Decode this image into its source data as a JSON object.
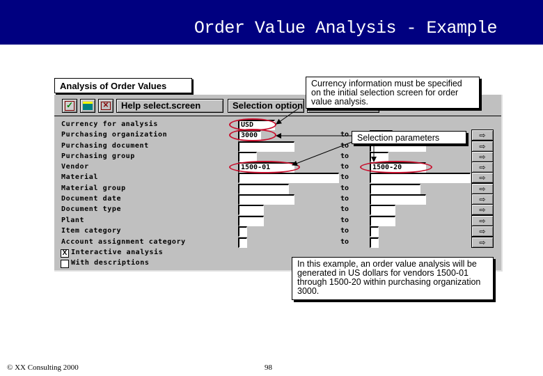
{
  "slide": {
    "title": "Order Value Analysis - Example",
    "footer_copyright": "© XX Consulting 2000",
    "page_number": "98"
  },
  "sap_window": {
    "title": "Analysis of Order Values",
    "toolbar": {
      "icons": [
        "execute-check-icon",
        "print-icon",
        "cancel-icon"
      ],
      "buttons": [
        "Help select.screen",
        "Selection options"
      ]
    },
    "rows": [
      {
        "label": "Currency for analysis",
        "from": "USD",
        "to_label": "",
        "to": "",
        "has_range": false
      },
      {
        "label": "Purchasing organization",
        "from": "3000",
        "to_label": "to",
        "to": "",
        "has_range": true
      },
      {
        "label": "Purchasing document",
        "from": "",
        "to_label": "to",
        "to": "",
        "has_range": true
      },
      {
        "label": "Purchasing group",
        "from": "",
        "to_label": "to",
        "to": "",
        "has_range": true
      },
      {
        "label": "Vendor",
        "from": "1500-01",
        "to_label": "to",
        "to": "1500-20",
        "has_range": true
      },
      {
        "label": "Material",
        "from": "",
        "to_label": "to",
        "to": "",
        "has_range": true
      },
      {
        "label": "Material group",
        "from": "",
        "to_label": "to",
        "to": "",
        "has_range": true
      },
      {
        "label": "Document date",
        "from": "",
        "to_label": "to",
        "to": "",
        "has_range": true
      },
      {
        "label": "Document type",
        "from": "",
        "to_label": "to",
        "to": "",
        "has_range": true
      },
      {
        "label": "Plant",
        "from": "",
        "to_label": "to",
        "to": "",
        "has_range": true
      },
      {
        "label": "Item category",
        "from": "",
        "to_label": "to",
        "to": "",
        "has_range": true
      },
      {
        "label": "Account assignment category",
        "from": "",
        "to_label": "to",
        "to": "",
        "has_range": true
      }
    ],
    "checkboxes": [
      {
        "label": "Interactive analysis",
        "checked": true,
        "mark": "X"
      },
      {
        "label": "With descriptions",
        "checked": false,
        "mark": ""
      }
    ]
  },
  "callouts": {
    "currency": "Currency information must be specified on the initial selection screen for order value analysis.",
    "selection": "Selection parameters",
    "example": "In this example, an order value analysis will be generated in US dollars for vendors 1500-01 through 1500-20 within purchasing organization 3000."
  },
  "colors": {
    "banner": "#000080",
    "highlight": "#c8102e",
    "window_bg": "#c0c0c0"
  }
}
